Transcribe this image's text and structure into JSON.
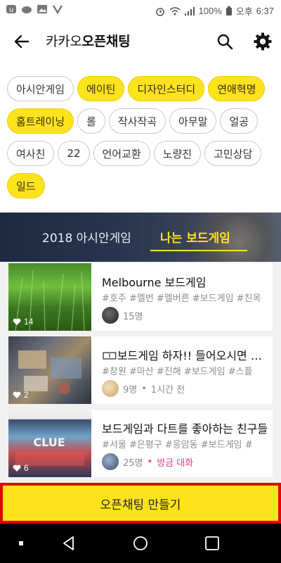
{
  "status_bar": {
    "battery": "100%",
    "time_period": "오후",
    "time": "6:37"
  },
  "header": {
    "title_prefix": "카카오",
    "title_bold": "오픈채팅",
    "icons": [
      "back-arrow-icon",
      "search-icon",
      "gear-icon"
    ]
  },
  "tags": [
    [
      {
        "label": "아시안게임",
        "highlighted": false
      },
      {
        "label": "에이틴",
        "highlighted": true
      },
      {
        "label": "디자인스터디",
        "highlighted": true
      },
      {
        "label": "연애혁명",
        "highlighted": true
      }
    ],
    [
      {
        "label": "홈트레이닝",
        "highlighted": true
      },
      {
        "label": "롤",
        "highlighted": false
      },
      {
        "label": "작사작곡",
        "highlighted": false
      },
      {
        "label": "아무말",
        "highlighted": false
      },
      {
        "label": "얼공",
        "highlighted": false
      }
    ],
    [
      {
        "label": "여사친",
        "highlighted": false
      },
      {
        "label": "22",
        "highlighted": false
      },
      {
        "label": "언어교환",
        "highlighted": false
      },
      {
        "label": "노량진",
        "highlighted": false
      },
      {
        "label": "고민상담",
        "highlighted": false
      }
    ],
    [
      {
        "label": "일드",
        "highlighted": true
      }
    ]
  ],
  "banner": {
    "tab1": "2018 아시안게임",
    "tab2": "나는 보드게임",
    "active_color": "#fde31c"
  },
  "rooms": [
    {
      "name": "Melbourne 보드게임",
      "hashtags": "#호주 #멜번 #멜버른 #보드게임 #친목",
      "members": "15명",
      "last_active": "",
      "likes": "14"
    },
    {
      "name": "🀱보드게임 하자!! 들어오시면 후회안함",
      "hashtags": "#창원 #마산 #진해 #보드게임 #스플",
      "members": "9명",
      "last_active": "1시간 전",
      "likes": "2"
    },
    {
      "name": "보드게임과 다트를 좋아하는 친구들",
      "hashtags": "#서울 #은평구 #응암동 #보드게임 #",
      "members": "25명",
      "last_active": "방금 대화",
      "likes": "6"
    }
  ],
  "cta": {
    "label": "오픈채팅 만들기",
    "color": "#fde31c",
    "border_color": "#e60000"
  },
  "accent_color": "#fde31c"
}
